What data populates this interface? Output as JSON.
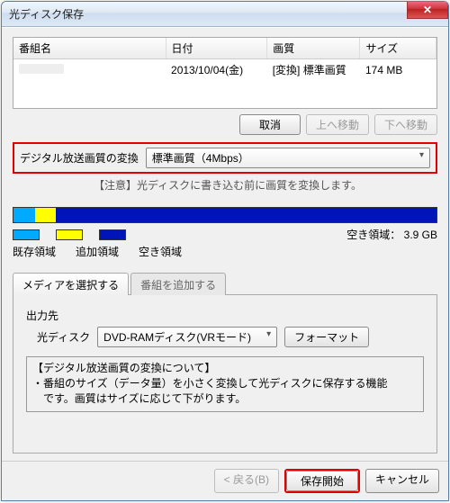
{
  "window": {
    "title": "光ディスク保存"
  },
  "grid": {
    "cols": [
      "番組名",
      "日付",
      "画質",
      "サイズ"
    ],
    "row": {
      "date": "2013/10/04(金)",
      "quality": "[変換] 標準画質",
      "size": "174 MB"
    }
  },
  "btns": {
    "cancel_op": "取消",
    "move_up": "上へ移動",
    "move_down": "下へ移動"
  },
  "convert": {
    "label": "デジタル放送画質の変換",
    "value": "標準画質（4Mbps）",
    "note": "【注意】光ディスクに書き込む前に画質を変換します。"
  },
  "usage": {
    "legend": {
      "existing": "既存領域",
      "added": "追加領域",
      "free": "空き領域"
    },
    "free_label": "空き領域：",
    "free_value": "3.9 GB"
  },
  "tabs": {
    "select_media": "メディアを選択する",
    "add_program": "番組を追加する"
  },
  "output": {
    "section": "出力先",
    "label": "光ディスク",
    "value": "DVD-RAMディスク(VRモード)",
    "format_btn": "フォーマット"
  },
  "info": {
    "title": "【デジタル放送画質の変換について】",
    "body1": "・番組のサイズ（データ量）を小さく変換して光ディスクに保存する機能",
    "body2": "　です。画質はサイズに応じて下がります。"
  },
  "footer": {
    "back": "< 戻る(B)",
    "save": "保存開始",
    "cancel": "キャンセル"
  }
}
